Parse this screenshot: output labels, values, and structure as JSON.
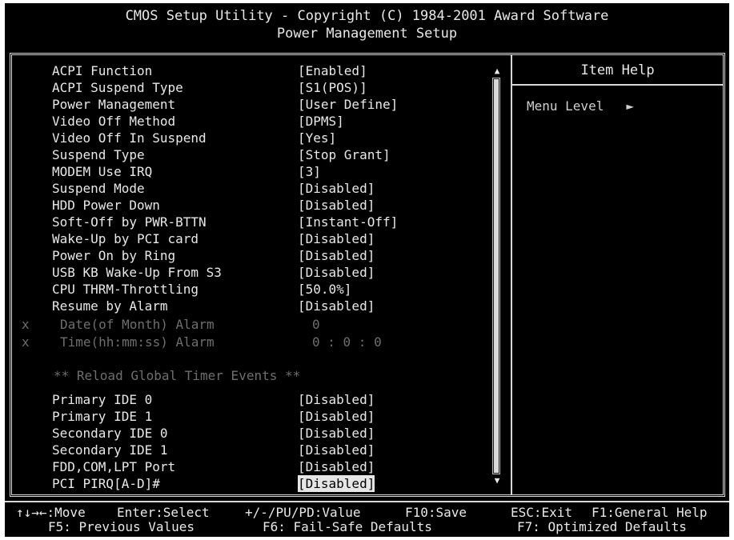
{
  "title": {
    "line1": "CMOS Setup Utility - Copyright (C) 1984-2001 Award Software",
    "line2": "Power Management Setup"
  },
  "settings": [
    {
      "label": "ACPI Function",
      "value": "[Enabled]"
    },
    {
      "label": "ACPI Suspend Type",
      "value": "[S1(POS)]"
    },
    {
      "label": "Power Management",
      "value": "[User Define]"
    },
    {
      "label": "Video Off Method",
      "value": "[DPMS]"
    },
    {
      "label": "Video Off In Suspend",
      "value": "[Yes]"
    },
    {
      "label": "Suspend Type",
      "value": "[Stop Grant]"
    },
    {
      "label": "MODEM Use IRQ",
      "value": "[3]"
    },
    {
      "label": "Suspend Mode",
      "value": "[Disabled]"
    },
    {
      "label": "HDD Power Down",
      "value": "[Disabled]"
    },
    {
      "label": "Soft-Off by PWR-BTTN",
      "value": "[Instant-Off]"
    },
    {
      "label": "Wake-Up by PCI card",
      "value": "[Disabled]"
    },
    {
      "label": "Power On by Ring",
      "value": "[Disabled]"
    },
    {
      "label": "USB KB Wake-Up From S3",
      "value": "[Disabled]"
    },
    {
      "label": "CPU THRM-Throttling",
      "value": "[50.0%]"
    },
    {
      "label": "Resume by Alarm",
      "value": "[Disabled]"
    }
  ],
  "disabled_settings": [
    {
      "mark": "x",
      "label": "Date(of Month) Alarm",
      "value": "0"
    },
    {
      "mark": "x",
      "label": "Time(hh:mm:ss) Alarm",
      "value": "0 : 0 : 0"
    }
  ],
  "section_header": "** Reload Global Timer Events **",
  "timer_settings": [
    {
      "label": "Primary IDE 0",
      "value": "[Disabled]"
    },
    {
      "label": "Primary IDE 1",
      "value": "[Disabled]"
    },
    {
      "label": "Secondary IDE 0",
      "value": "[Disabled]"
    },
    {
      "label": "Secondary IDE 1",
      "value": "[Disabled]"
    },
    {
      "label": "FDD,COM,LPT Port",
      "value": "[Disabled]"
    },
    {
      "label": "PCI PIRQ[A-D]#",
      "value": "[Disabled]"
    }
  ],
  "help": {
    "header": "Item Help",
    "menu_level_label": "Menu Level",
    "menu_level_arrow": "►"
  },
  "scrollbar": {
    "up": "▲",
    "down": "▼"
  },
  "footer": {
    "move": "↑↓→←:Move",
    "select": "Enter:Select",
    "value": "+/-/PU/PD:Value",
    "save": "F10:Save",
    "exit": "ESC:Exit",
    "help": "F1:General Help",
    "prev": "F5: Previous Values",
    "failsafe": "F6: Fail-Safe Defaults",
    "optimized": "F7: Optimized Defaults"
  },
  "colors": {
    "background": "#000000",
    "text": "#e8e8e8",
    "dimmed": "#6e6e6e",
    "highlight": "#e6e6e6"
  }
}
